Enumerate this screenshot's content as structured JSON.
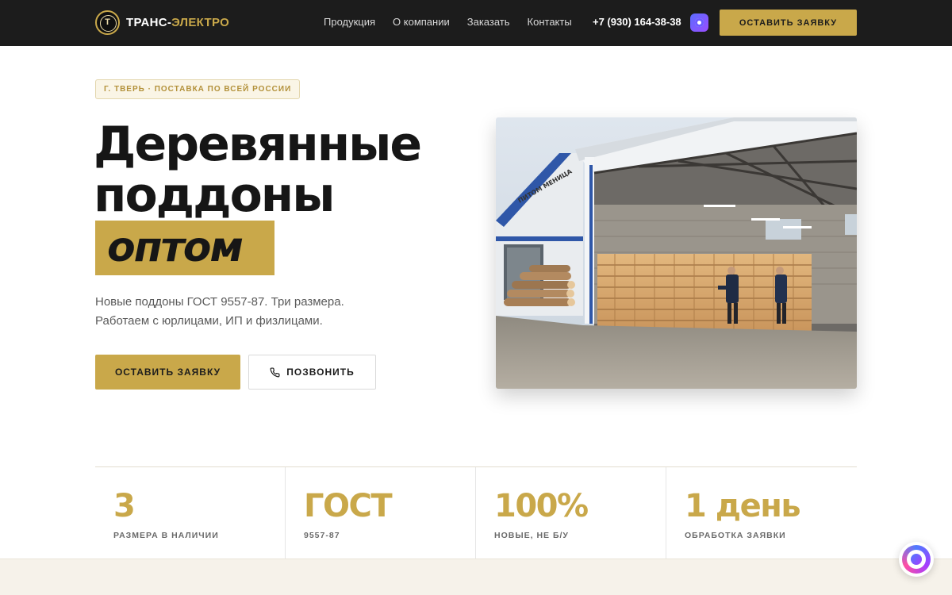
{
  "header": {
    "logo_initial": "Т",
    "logo_main": "ТРАНС-",
    "logo_accent": "ЭЛЕКТРО",
    "nav": [
      "Продукция",
      "О компании",
      "Заказать",
      "Контакты"
    ],
    "phone": "+7 (930) 164-38-38",
    "cta_label": "ОСТАВИТЬ ЗАЯВКУ"
  },
  "hero": {
    "tag": "Г. ТВЕРЬ · ПОСТАВКА ПО ВСЕЙ РОССИИ",
    "title_line1": "Деревянные",
    "title_line2": "поддоны",
    "title_highlight": "оптом",
    "subtitle_line1": "Новые поддоны ГОСТ 9557-87. Три размера.",
    "subtitle_line2": "Работаем с юрлицами, ИП и физлицами.",
    "primary_button": "ОСТАВИТЬ ЗАЯВКУ",
    "secondary_button": "ПОЗВОНИТЬ",
    "photo_sign": "ПИТОМ МЕНИЦА"
  },
  "stats": [
    {
      "value": "3",
      "label": "РАЗМЕРА В НАЛИЧИИ"
    },
    {
      "value": "ГОСТ",
      "label": "9557-87"
    },
    {
      "value": "100%",
      "label": "НОВЫЕ, НЕ Б/У"
    },
    {
      "value": "1 день",
      "label": "ОБРАБОТКА ЗАЯВКИ"
    }
  ],
  "colors": {
    "accent": "#c9a84a",
    "header_bg": "#1c1c1c",
    "text_dark": "#161616"
  },
  "icons": {
    "logo": "circle-emblem-icon",
    "chat_top": "chat-icon",
    "phone": "phone-icon",
    "chat_widget": "chat-widget-icon"
  }
}
